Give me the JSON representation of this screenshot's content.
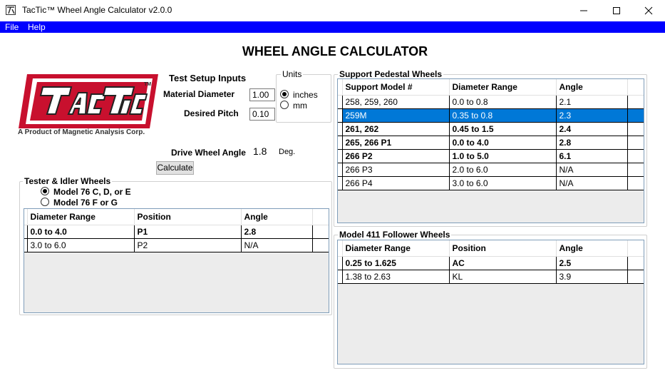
{
  "window": {
    "title": "TacTic™ Wheel Angle Calculator v2.0.0"
  },
  "menu": [
    "File",
    "Help"
  ],
  "heading": "WHEEL ANGLE CALCULATOR",
  "logo": {
    "text": "TACTIC",
    "tm": "TM",
    "caption": "A Product of Magnetic Analysis Corp."
  },
  "setup": {
    "title": "Test Setup Inputs",
    "material_diameter_label": "Material Diameter",
    "material_diameter_value": "1.00",
    "desired_pitch_label": "Desired Pitch",
    "desired_pitch_value": "0.10",
    "units_title": "Units",
    "units_options": [
      "inches",
      "mm"
    ],
    "units_selected": "inches",
    "drive_label": "Drive Wheel Angle",
    "drive_value": "1.8",
    "drive_unit": "Deg.",
    "calculate_label": "Calculate"
  },
  "tester": {
    "title": "Tester & Idler Wheels",
    "options": [
      "Model 76 C, D, or E",
      "Model 76 F or G"
    ],
    "selected": "Model 76 C, D, or E",
    "columns": [
      "Diameter Range",
      "Position",
      "Angle"
    ],
    "rows": [
      {
        "cells": [
          "0.0 to 4.0",
          "P1",
          "2.8"
        ],
        "bold": true
      },
      {
        "cells": [
          "3.0 to 6.0",
          "P2",
          "N/A"
        ],
        "bold": false
      }
    ]
  },
  "pedestal": {
    "title": "Support Pedestal Wheels",
    "columns": [
      "Support Model #",
      "Diameter Range",
      "Angle"
    ],
    "rows": [
      {
        "cells": [
          "258, 259, 260",
          "0.0 to 0.8",
          "2.1"
        ],
        "bold": false,
        "selected": false
      },
      {
        "cells": [
          "259M",
          "0.35 to 0.8",
          "2.3"
        ],
        "bold": false,
        "selected": true
      },
      {
        "cells": [
          "261, 262",
          "0.45 to 1.5",
          "2.4"
        ],
        "bold": true,
        "selected": false
      },
      {
        "cells": [
          "265, 266 P1",
          "0.0 to 4.0",
          "2.8"
        ],
        "bold": true,
        "selected": false
      },
      {
        "cells": [
          "266 P2",
          "1.0 to 5.0",
          "6.1"
        ],
        "bold": true,
        "selected": false
      },
      {
        "cells": [
          "266 P3",
          "2.0 to 6.0",
          "N/A"
        ],
        "bold": false,
        "selected": false
      },
      {
        "cells": [
          "266 P4",
          "3.0 to 6.0",
          "N/A"
        ],
        "bold": false,
        "selected": false
      }
    ]
  },
  "follower": {
    "title": "Model 411 Follower Wheels",
    "columns": [
      "Diameter Range",
      "Position",
      "Angle"
    ],
    "rows": [
      {
        "cells": [
          "0.25 to 1.625",
          "AC",
          "2.5"
        ],
        "bold": true
      },
      {
        "cells": [
          "1.38 to 2.63",
          "KL",
          "3.9"
        ],
        "bold": false
      }
    ]
  },
  "colors": {
    "menu_bar": "#0000ff",
    "selection": "#0078d7",
    "logo_red": "#c8102e"
  }
}
